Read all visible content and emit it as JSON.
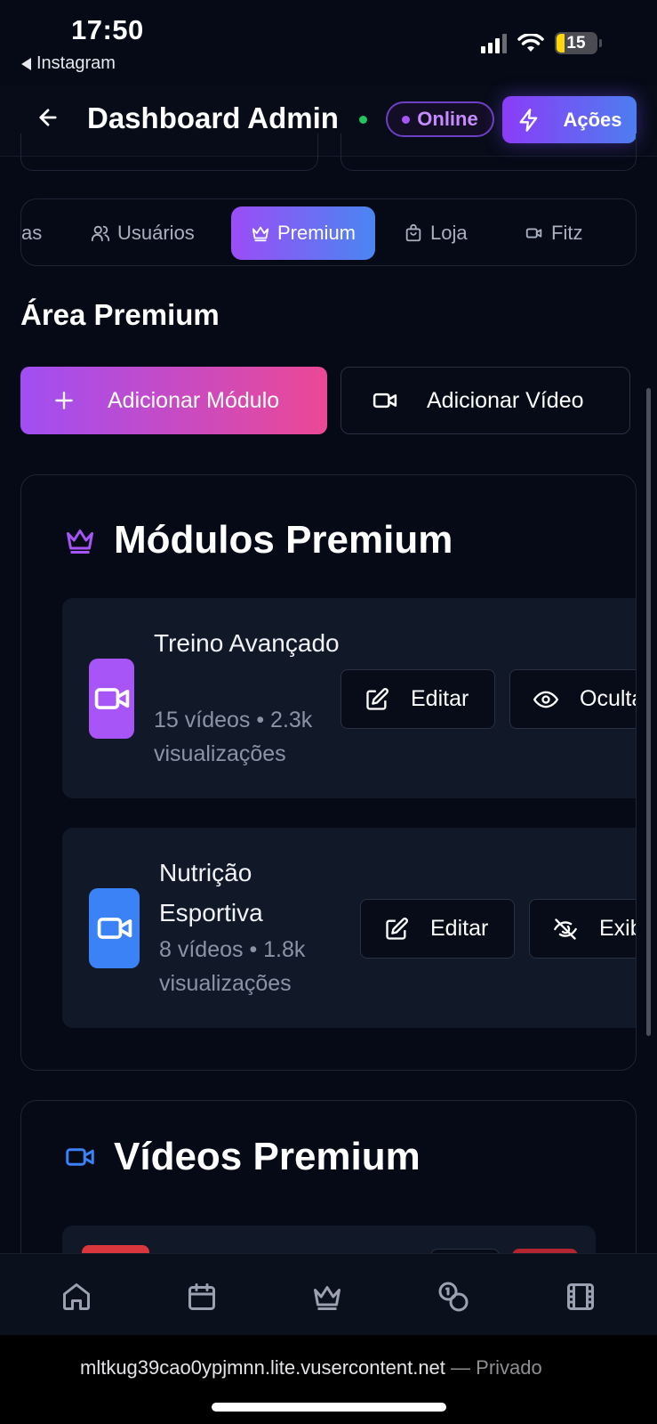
{
  "status_bar": {
    "time": "17:50",
    "back_app": "Instagram",
    "battery": "15"
  },
  "header": {
    "title": "Dashboard Admin",
    "status_badge": "Online",
    "actions_label": "Ações"
  },
  "tabs": [
    {
      "label": "as",
      "icon": "bar-chart-icon"
    },
    {
      "label": "Usuários",
      "icon": "users-icon"
    },
    {
      "label": "Premium",
      "icon": "crown-icon",
      "active": true
    },
    {
      "label": "Loja",
      "icon": "shopping-bag-icon"
    },
    {
      "label": "Fitz",
      "icon": "video-icon"
    }
  ],
  "premium_area": {
    "title": "Área Premium",
    "add_module_label": "Adicionar Módulo",
    "add_video_label": "Adicionar Vídeo"
  },
  "modules_card": {
    "title": "Módulos Premium",
    "modules": [
      {
        "name": "Treino Avançado",
        "meta": "15 vídeos • 2.3k visualizações",
        "edit_label": "Editar",
        "toggle_label": "Ocultar",
        "toggle_icon": "eye-icon",
        "color": "#a855f7"
      },
      {
        "name": "Nutrição Esportiva",
        "meta": "8 vídeos • 1.8k visualizações",
        "edit_label": "Editar",
        "toggle_label": "Exibir",
        "toggle_icon": "eye-off-icon",
        "color": "#3b82f6"
      }
    ]
  },
  "videos_card": {
    "title": "Vídeos Premium"
  },
  "bottom_nav": [
    "home-icon",
    "calendar-icon",
    "crown-icon",
    "coins-icon",
    "film-icon"
  ],
  "url_bar": {
    "host": "mltkug39cao0ypjmnn.lite.vusercontent.net",
    "suffix": "— Privado"
  },
  "colors": {
    "accent_purple": "#a855f7",
    "accent_blue": "#3b82f6",
    "accent_pink": "#ec4899",
    "online_green": "#22c55e",
    "background": "#050a16"
  }
}
